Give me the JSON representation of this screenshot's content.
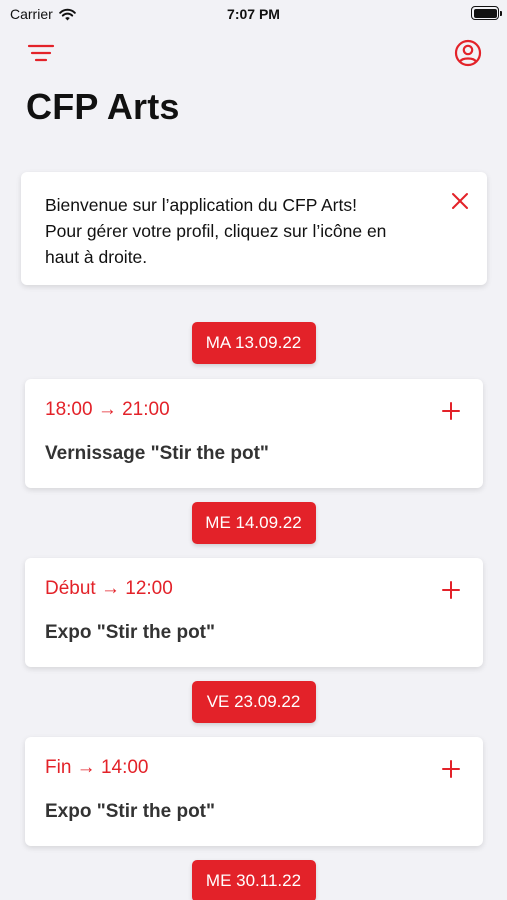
{
  "status_bar": {
    "carrier": "Carrier",
    "time": "7:07 PM"
  },
  "header": {
    "menu_icon": "hamburger-menu-icon",
    "profile_icon": "user-circle-icon",
    "title": "CFP Arts"
  },
  "welcome": {
    "line1": "Bienvenue sur l’application du CFP Arts!",
    "line2": "Pour gérer votre profil, cliquez sur l’icône en",
    "line3": "haut à droite."
  },
  "dates": [
    {
      "label": "MA 13.09.22"
    },
    {
      "label": "ME 14.09.22"
    },
    {
      "label": "VE 23.09.22"
    },
    {
      "label": "ME 30.11.22"
    }
  ],
  "events": [
    {
      "time": "18:00 → 21:00",
      "title": "Vernissage \"Stir the pot\""
    },
    {
      "time": "Début → 12:00",
      "title": "Expo \"Stir the pot\""
    },
    {
      "time": "Fin → 14:00",
      "title": "Expo \"Stir the pot\""
    }
  ],
  "colors": {
    "accent": "#e32229",
    "background": "#f2f2f6",
    "card": "#ffffff"
  }
}
